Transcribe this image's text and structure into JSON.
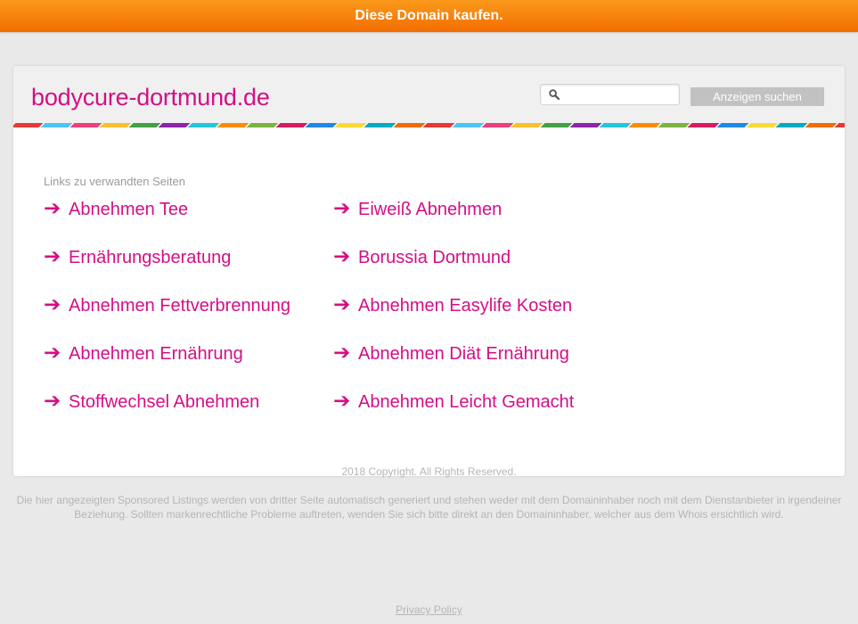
{
  "top_banner": {
    "label": "Diese Domain kaufen."
  },
  "header": {
    "site_title": "bodycure-dortmund.de",
    "search_placeholder": "",
    "search_button_label": "Anzeigen suchen"
  },
  "colors": {
    "accent": "#d40f85",
    "banner": "#f47d0a",
    "stripe": [
      "#e53935",
      "#4fc3f7",
      "#ec407a",
      "#fbc02d",
      "#43a047",
      "#8e24aa",
      "#26c6da",
      "#fb8c00",
      "#7cb342",
      "#d81b60",
      "#1e88e5",
      "#fdd835",
      "#00acc1",
      "#ef6c00"
    ]
  },
  "related": {
    "heading": "Links zu verwandten Seiten",
    "column1": [
      "Abnehmen Tee",
      "Ernährungsberatung",
      "Abnehmen Fettverbrennung",
      "Abnehmen Ernährung",
      "Stoffwechsel Abnehmen"
    ],
    "column2": [
      "Eiweiß Abnehmen",
      "Borussia Dortmund",
      "Abnehmen Easylife Kosten",
      "Abnehmen Diät Ernährung",
      "Abnehmen Leicht Gemacht"
    ],
    "arrow_glyph": "➔"
  },
  "footer": {
    "copyright": "2018 Copyright. All Rights Reserved.",
    "disclaimer": "Die hier angezeigten Sponsored Listings werden von dritter Seite automatisch generiert und stehen weder mit dem Domaininhaber noch mit dem Dienstanbieter in irgendeiner Beziehung. Sollten markenrechtliche Probleme auftreten, wenden Sie sich bitte direkt an den Domaininhaber, welcher aus dem Whois ersichtlich wird.",
    "privacy_label": "Privacy Policy"
  },
  "icons": {
    "search": "search-icon",
    "arrow": "arrow-right-icon"
  }
}
